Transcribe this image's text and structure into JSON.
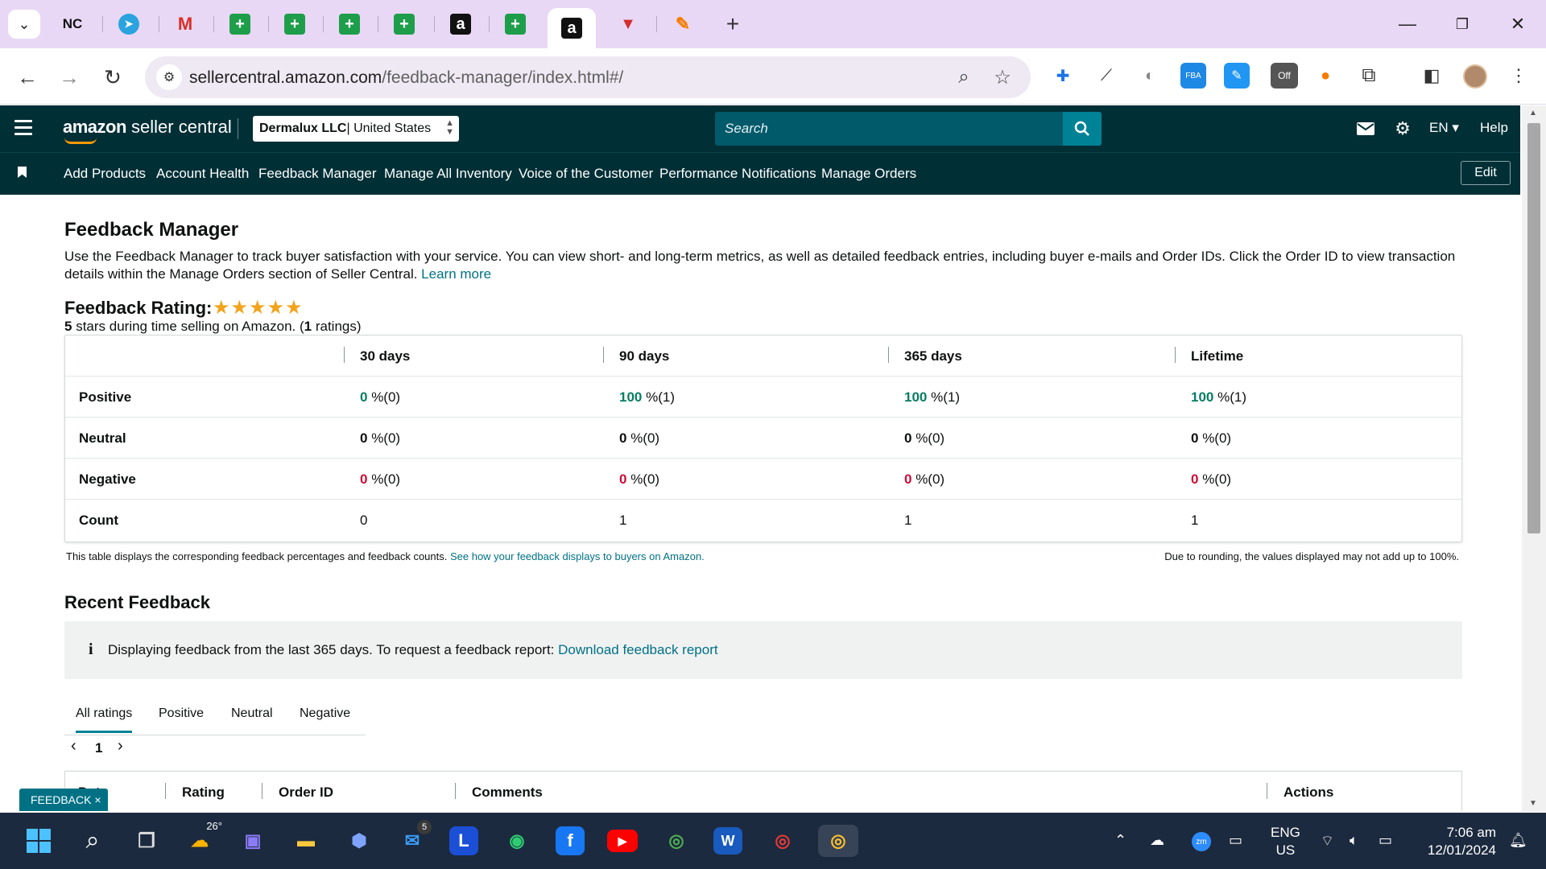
{
  "browser": {
    "tabs": [
      {
        "label": "NC",
        "icon": "nc-icon"
      },
      {
        "label": "",
        "icon": "telegram-icon"
      },
      {
        "label": "M",
        "icon": "gmail-icon"
      },
      {
        "label": "",
        "icon": "sheets-icon"
      },
      {
        "label": "",
        "icon": "sheets-icon"
      },
      {
        "label": "",
        "icon": "sheets-icon"
      },
      {
        "label": "",
        "icon": "sheets-icon"
      },
      {
        "label": "a",
        "icon": "amazon-icon"
      },
      {
        "label": "",
        "icon": "sheets-icon"
      },
      {
        "label": "a",
        "icon": "amazon-icon"
      },
      {
        "label": "",
        "icon": "red-triangle-icon"
      },
      {
        "label": "",
        "icon": "pen-icon"
      }
    ],
    "url_host": "sellercentral.amazon.com",
    "url_path": "/feedback-manager/index.html#/",
    "extension_off_badge": "Off"
  },
  "header": {
    "logo_main": "amazon",
    "logo_rest": " seller central",
    "account_name": "Dermalux LLC",
    "account_region": " | United States",
    "search_placeholder": "Search",
    "language": "EN",
    "help": "Help"
  },
  "nav": {
    "items": [
      "Add Products",
      "Account Health",
      "Feedback Manager",
      "Manage All Inventory",
      "Voice of the Customer",
      "Performance Notifications",
      "Manage Orders"
    ],
    "edit": "Edit"
  },
  "page": {
    "title": "Feedback Manager",
    "intro": "Use the Feedback Manager to track buyer satisfaction with your service. You can view short- and long-term metrics, as well as detailed feedback entries, including buyer e-mails and Order IDs. Click the Order ID to view transaction details within the Manage Orders section of Seller Central. ",
    "learn_more": "Learn more",
    "rating_title": "Feedback Rating:",
    "stars": 5,
    "rating_sub_stars": "5",
    "rating_sub_mid": " stars during time selling on Amazon. (",
    "rating_sub_count": "1",
    "rating_sub_end": " ratings)"
  },
  "feedback_table": {
    "columns": [
      "30 days",
      "90 days",
      "365 days",
      "Lifetime"
    ],
    "rows": [
      {
        "label": "Positive",
        "cells": [
          [
            "0",
            " %(0)"
          ],
          [
            "100",
            " %(1)"
          ],
          [
            "100",
            " %(1)"
          ],
          [
            "100",
            " %(1)"
          ]
        ]
      },
      {
        "label": "Neutral",
        "cells": [
          [
            "0",
            " %(0)"
          ],
          [
            "0",
            " %(0)"
          ],
          [
            "0",
            " %(0)"
          ],
          [
            "0",
            " %(0)"
          ]
        ]
      },
      {
        "label": "Negative",
        "cells": [
          [
            "0",
            " %(0)"
          ],
          [
            "0",
            " %(0)"
          ],
          [
            "0",
            " %(0)"
          ],
          [
            "0",
            " %(0)"
          ]
        ]
      },
      {
        "label": "Count",
        "cells": [
          [
            "0",
            ""
          ],
          [
            "1",
            ""
          ],
          [
            "1",
            ""
          ],
          [
            "1",
            ""
          ]
        ]
      }
    ],
    "note_left": "This table displays the corresponding feedback percentages and feedback counts. ",
    "note_link": "See how your feedback displays to buyers on Amazon.",
    "note_right": "Due to rounding, the values displayed may not add up to 100%."
  },
  "recent": {
    "title": "Recent Feedback",
    "info_icon": "i",
    "info_text": "Displaying feedback from the last 365 days. To request a feedback report: ",
    "info_link": "Download feedback report",
    "tabs": [
      "All ratings",
      "Positive",
      "Neutral",
      "Negative"
    ],
    "active_tab": "All ratings",
    "page": "1",
    "prev": "‹",
    "next": "›",
    "list_columns": [
      "Date",
      "Rating",
      "Order ID",
      "Comments",
      "Actions"
    ]
  },
  "feedback_chip": "FEEDBACK ×",
  "taskbar": {
    "weather_temp": "26°",
    "mail_badge": "5",
    "lang_top": "ENG",
    "lang_bottom": "US",
    "time": "7:06 am",
    "date": "12/01/2024"
  }
}
